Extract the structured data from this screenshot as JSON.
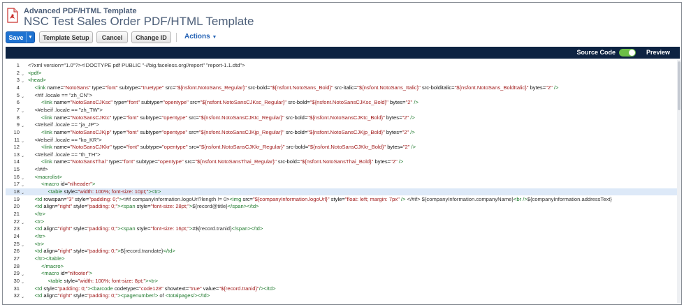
{
  "header": {
    "record_type": "Advanced PDF/HTML Template",
    "title": "NSC Test Sales Order PDF/HTML Template"
  },
  "toolbar": {
    "save_label": "Save",
    "template_setup_label": "Template Setup",
    "cancel_label": "Cancel",
    "change_id_label": "Change ID",
    "actions_label": "Actions"
  },
  "editor_bar": {
    "source_code_label": "Source Code",
    "source_code_on": true,
    "preview_label": "Preview"
  },
  "colors": {
    "save_button": "#1f73d1",
    "dark_bar": "#0d2342",
    "toggle_on": "#6cbf47",
    "tag": "#1f7a2d",
    "string": "#a01b1b",
    "active_line": "#dde9f8"
  },
  "code_lines": [
    {
      "n": "1",
      "fold": false,
      "active": false,
      "indent": 0,
      "tokens": [
        [
          "p",
          "<?xml version=\"1.0\"?><!DOCTYPE pdf PUBLIC \"-//big.faceless.org//report\" \"report-1.1.dtd\">"
        ]
      ]
    },
    {
      "n": "2",
      "fold": true,
      "active": false,
      "indent": 0,
      "tokens": [
        [
          "t",
          "<pdf>"
        ]
      ]
    },
    {
      "n": "3",
      "fold": true,
      "active": false,
      "indent": 0,
      "tokens": [
        [
          "t",
          "<head>"
        ]
      ]
    },
    {
      "n": "4",
      "fold": false,
      "active": false,
      "indent": 1,
      "tokens": [
        [
          "t",
          "<link "
        ],
        [
          "a",
          "name="
        ],
        [
          "s",
          "\"NotoSans\""
        ],
        [
          "a",
          " type="
        ],
        [
          "s",
          "\"font\""
        ],
        [
          "a",
          " subtype="
        ],
        [
          "s",
          "\"truetype\""
        ],
        [
          "a",
          " src="
        ],
        [
          "s",
          "\"${nsfont.NotoSans_Regular}\""
        ],
        [
          "a",
          " src-bold="
        ],
        [
          "s",
          "\"${nsfont.NotoSans_Bold}\""
        ],
        [
          "a",
          " src-italic="
        ],
        [
          "s",
          "\"${nsfont.NotoSans_Italic}\""
        ],
        [
          "a",
          " src-bolditalic="
        ],
        [
          "s",
          "\"${nsfont.NotoSans_BoldItalic}\""
        ],
        [
          "a",
          " bytes="
        ],
        [
          "s",
          "\"2\""
        ],
        [
          "t",
          " />"
        ]
      ]
    },
    {
      "n": "5",
      "fold": true,
      "active": false,
      "indent": 1,
      "tokens": [
        [
          "p",
          "<#if .locale == \"zh_CN\">"
        ]
      ]
    },
    {
      "n": "6",
      "fold": false,
      "active": false,
      "indent": 2,
      "tokens": [
        [
          "t",
          "<link "
        ],
        [
          "a",
          "name="
        ],
        [
          "s",
          "\"NotoSansCJKsc\""
        ],
        [
          "a",
          " type="
        ],
        [
          "s",
          "\"font\""
        ],
        [
          "a",
          " subtype="
        ],
        [
          "s",
          "\"opentype\""
        ],
        [
          "a",
          " src="
        ],
        [
          "s",
          "\"${nsfont.NotoSansCJKsc_Regular}\""
        ],
        [
          "a",
          " src-bold="
        ],
        [
          "s",
          "\"${nsfont.NotoSansCJKsc_Bold}\""
        ],
        [
          "a",
          " bytes="
        ],
        [
          "s",
          "\"2\""
        ],
        [
          "t",
          " />"
        ]
      ]
    },
    {
      "n": "7",
      "fold": true,
      "active": false,
      "indent": 1,
      "tokens": [
        [
          "p",
          "<#elseif .locale == \"zh_TW\">"
        ]
      ]
    },
    {
      "n": "8",
      "fold": false,
      "active": false,
      "indent": 2,
      "tokens": [
        [
          "t",
          "<link "
        ],
        [
          "a",
          "name="
        ],
        [
          "s",
          "\"NotoSansCJKtc\""
        ],
        [
          "a",
          " type="
        ],
        [
          "s",
          "\"font\""
        ],
        [
          "a",
          " subtype="
        ],
        [
          "s",
          "\"opentype\""
        ],
        [
          "a",
          " src="
        ],
        [
          "s",
          "\"${nsfont.NotoSansCJKtc_Regular}\""
        ],
        [
          "a",
          " src-bold="
        ],
        [
          "s",
          "\"${nsfont.NotoSansCJKtc_Bold}\""
        ],
        [
          "a",
          " bytes="
        ],
        [
          "s",
          "\"2\""
        ],
        [
          "t",
          " />"
        ]
      ]
    },
    {
      "n": "9",
      "fold": true,
      "active": false,
      "indent": 1,
      "tokens": [
        [
          "p",
          "<#elseif .locale == \"ja_JP\">"
        ]
      ]
    },
    {
      "n": "10",
      "fold": false,
      "active": false,
      "indent": 2,
      "tokens": [
        [
          "t",
          "<link "
        ],
        [
          "a",
          "name="
        ],
        [
          "s",
          "\"NotoSansCJKjp\""
        ],
        [
          "a",
          " type="
        ],
        [
          "s",
          "\"font\""
        ],
        [
          "a",
          " subtype="
        ],
        [
          "s",
          "\"opentype\""
        ],
        [
          "a",
          " src="
        ],
        [
          "s",
          "\"${nsfont.NotoSansCJKjp_Regular}\""
        ],
        [
          "a",
          " src-bold="
        ],
        [
          "s",
          "\"${nsfont.NotoSansCJKjp_Bold}\""
        ],
        [
          "a",
          " bytes="
        ],
        [
          "s",
          "\"2\""
        ],
        [
          "t",
          " />"
        ]
      ]
    },
    {
      "n": "11",
      "fold": true,
      "active": false,
      "indent": 1,
      "tokens": [
        [
          "p",
          "<#elseif .locale == \"ko_KR\">"
        ]
      ]
    },
    {
      "n": "12",
      "fold": false,
      "active": false,
      "indent": 2,
      "tokens": [
        [
          "t",
          "<link "
        ],
        [
          "a",
          "name="
        ],
        [
          "s",
          "\"NotoSansCJKkr\""
        ],
        [
          "a",
          " type="
        ],
        [
          "s",
          "\"font\""
        ],
        [
          "a",
          " subtype="
        ],
        [
          "s",
          "\"opentype\""
        ],
        [
          "a",
          " src="
        ],
        [
          "s",
          "\"${nsfont.NotoSansCJKkr_Regular}\""
        ],
        [
          "a",
          " src-bold="
        ],
        [
          "s",
          "\"${nsfont.NotoSansCJKkr_Bold}\""
        ],
        [
          "a",
          " bytes="
        ],
        [
          "s",
          "\"2\""
        ],
        [
          "t",
          " />"
        ]
      ]
    },
    {
      "n": "13",
      "fold": true,
      "active": false,
      "indent": 1,
      "tokens": [
        [
          "p",
          "<#elseif .locale == \"th_TH\">"
        ]
      ]
    },
    {
      "n": "14",
      "fold": false,
      "active": false,
      "indent": 2,
      "tokens": [
        [
          "t",
          "<link "
        ],
        [
          "a",
          "name="
        ],
        [
          "s",
          "\"NotoSansThai\""
        ],
        [
          "a",
          " type="
        ],
        [
          "s",
          "\"font\""
        ],
        [
          "a",
          " subtype="
        ],
        [
          "s",
          "\"opentype\""
        ],
        [
          "a",
          " src="
        ],
        [
          "s",
          "\"${nsfont.NotoSansThai_Regular}\""
        ],
        [
          "a",
          " src-bold="
        ],
        [
          "s",
          "\"${nsfont.NotoSansThai_Bold}\""
        ],
        [
          "a",
          " bytes="
        ],
        [
          "s",
          "\"2\""
        ],
        [
          "t",
          " />"
        ]
      ]
    },
    {
      "n": "15",
      "fold": false,
      "active": false,
      "indent": 1,
      "tokens": [
        [
          "p",
          "</#if>"
        ]
      ]
    },
    {
      "n": "16",
      "fold": true,
      "active": false,
      "indent": 1,
      "tokens": [
        [
          "t",
          "<macrolist>"
        ]
      ]
    },
    {
      "n": "17",
      "fold": true,
      "active": false,
      "indent": 2,
      "tokens": [
        [
          "t",
          "<macro "
        ],
        [
          "a",
          "id="
        ],
        [
          "s",
          "\"nlheader\""
        ],
        [
          "t",
          ">"
        ]
      ]
    },
    {
      "n": "18",
      "fold": true,
      "active": true,
      "indent": 3,
      "tokens": [
        [
          "t",
          "<table "
        ],
        [
          "a",
          "style="
        ],
        [
          "s",
          "\"width: 100%; font-size: 10pt;\""
        ],
        [
          "t",
          "><tr>"
        ]
      ]
    },
    {
      "n": "19",
      "fold": false,
      "active": false,
      "indent": 1,
      "tokens": [
        [
          "t",
          "<td "
        ],
        [
          "a",
          "rowspan="
        ],
        [
          "s",
          "\"3\""
        ],
        [
          "a",
          " style="
        ],
        [
          "s",
          "\"padding: 0;\""
        ],
        [
          "t",
          ">"
        ],
        [
          "p",
          "<#if companyInformation.logoUrl?length != 0>"
        ],
        [
          "t",
          "<img "
        ],
        [
          "a",
          "src="
        ],
        [
          "s",
          "\"${companyInformation.logoUrl}\""
        ],
        [
          "a",
          " style="
        ],
        [
          "s",
          "\"float: left; margin: 7px\""
        ],
        [
          "t",
          " /> "
        ],
        [
          "p",
          "</#if> ${companyInformation.companyName}"
        ],
        [
          "t",
          "<br />"
        ],
        [
          "p",
          "${companyInformation.addressText}"
        ]
      ]
    },
    {
      "n": "20",
      "fold": false,
      "active": false,
      "indent": 1,
      "tokens": [
        [
          "t",
          "<td "
        ],
        [
          "a",
          "align="
        ],
        [
          "s",
          "\"right\""
        ],
        [
          "a",
          " style="
        ],
        [
          "s",
          "\"padding: 0;\""
        ],
        [
          "t",
          "><span "
        ],
        [
          "a",
          "style="
        ],
        [
          "s",
          "\"font-size: 28pt;\""
        ],
        [
          "t",
          ">"
        ],
        [
          "p",
          "${record@title}"
        ],
        [
          "t",
          "</span></td>"
        ]
      ]
    },
    {
      "n": "21",
      "fold": false,
      "active": false,
      "indent": 1,
      "tokens": [
        [
          "t",
          "</tr>"
        ]
      ]
    },
    {
      "n": "22",
      "fold": true,
      "active": false,
      "indent": 1,
      "tokens": [
        [
          "t",
          "<tr>"
        ]
      ]
    },
    {
      "n": "23",
      "fold": false,
      "active": false,
      "indent": 1,
      "tokens": [
        [
          "t",
          "<td "
        ],
        [
          "a",
          "align="
        ],
        [
          "s",
          "\"right\""
        ],
        [
          "a",
          " style="
        ],
        [
          "s",
          "\"padding: 0;\""
        ],
        [
          "t",
          "><span "
        ],
        [
          "a",
          "style="
        ],
        [
          "s",
          "\"font-size: 16pt;\""
        ],
        [
          "t",
          ">"
        ],
        [
          "p",
          "#${record.tranid}"
        ],
        [
          "t",
          "</span></td>"
        ]
      ]
    },
    {
      "n": "24",
      "fold": false,
      "active": false,
      "indent": 1,
      "tokens": [
        [
          "t",
          "</tr>"
        ]
      ]
    },
    {
      "n": "25",
      "fold": true,
      "active": false,
      "indent": 1,
      "tokens": [
        [
          "t",
          "<tr>"
        ]
      ]
    },
    {
      "n": "26",
      "fold": false,
      "active": false,
      "indent": 1,
      "tokens": [
        [
          "t",
          "<td "
        ],
        [
          "a",
          "align="
        ],
        [
          "s",
          "\"right\""
        ],
        [
          "a",
          " style="
        ],
        [
          "s",
          "\"padding: 0;\""
        ],
        [
          "t",
          ">"
        ],
        [
          "p",
          "${record.trandate}"
        ],
        [
          "t",
          "</td>"
        ]
      ]
    },
    {
      "n": "27",
      "fold": false,
      "active": false,
      "indent": 1,
      "tokens": [
        [
          "t",
          "</tr></table>"
        ]
      ]
    },
    {
      "n": "28",
      "fold": false,
      "active": false,
      "indent": 2,
      "tokens": [
        [
          "t",
          "</macro>"
        ]
      ]
    },
    {
      "n": "29",
      "fold": true,
      "active": false,
      "indent": 2,
      "tokens": [
        [
          "t",
          "<macro "
        ],
        [
          "a",
          "id="
        ],
        [
          "s",
          "\"nlfooter\""
        ],
        [
          "t",
          ">"
        ]
      ]
    },
    {
      "n": "30",
      "fold": true,
      "active": false,
      "indent": 3,
      "tokens": [
        [
          "t",
          "<table "
        ],
        [
          "a",
          "style="
        ],
        [
          "s",
          "\"width: 100%; font-size: 8pt;\""
        ],
        [
          "t",
          "><tr>"
        ]
      ]
    },
    {
      "n": "31",
      "fold": false,
      "active": false,
      "indent": 1,
      "tokens": [
        [
          "t",
          "<td "
        ],
        [
          "a",
          "style="
        ],
        [
          "s",
          "\"padding: 0;\""
        ],
        [
          "t",
          "><barcode "
        ],
        [
          "a",
          "codetype="
        ],
        [
          "s",
          "\"code128\""
        ],
        [
          "a",
          " showtext="
        ],
        [
          "s",
          "\"true\""
        ],
        [
          "a",
          " value="
        ],
        [
          "s",
          "\"${record.tranid}\""
        ],
        [
          "t",
          "/></td>"
        ]
      ]
    },
    {
      "n": "32",
      "fold": true,
      "active": false,
      "indent": 1,
      "tokens": [
        [
          "t",
          "<td "
        ],
        [
          "a",
          "align="
        ],
        [
          "s",
          "\"right\""
        ],
        [
          "a",
          " style="
        ],
        [
          "s",
          "\"padding: 0;\""
        ],
        [
          "t",
          "><pagenumber/> "
        ],
        [
          "p",
          "of"
        ],
        [
          "t",
          " <totalpages/></td>"
        ]
      ]
    }
  ]
}
